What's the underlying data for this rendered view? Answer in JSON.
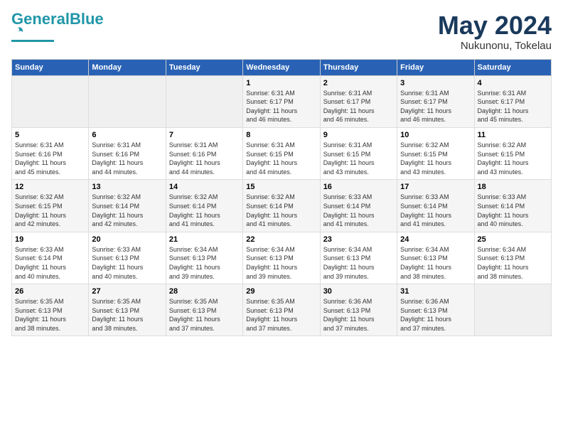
{
  "logo": {
    "general": "General",
    "blue": "Blue"
  },
  "title": {
    "month_year": "May 2024",
    "location": "Nukunonu, Tokelau"
  },
  "weekdays": [
    "Sunday",
    "Monday",
    "Tuesday",
    "Wednesday",
    "Thursday",
    "Friday",
    "Saturday"
  ],
  "weeks": [
    [
      {
        "num": "",
        "info": ""
      },
      {
        "num": "",
        "info": ""
      },
      {
        "num": "",
        "info": ""
      },
      {
        "num": "1",
        "info": "Sunrise: 6:31 AM\nSunset: 6:17 PM\nDaylight: 11 hours\nand 46 minutes."
      },
      {
        "num": "2",
        "info": "Sunrise: 6:31 AM\nSunset: 6:17 PM\nDaylight: 11 hours\nand 46 minutes."
      },
      {
        "num": "3",
        "info": "Sunrise: 6:31 AM\nSunset: 6:17 PM\nDaylight: 11 hours\nand 46 minutes."
      },
      {
        "num": "4",
        "info": "Sunrise: 6:31 AM\nSunset: 6:17 PM\nDaylight: 11 hours\nand 45 minutes."
      }
    ],
    [
      {
        "num": "5",
        "info": "Sunrise: 6:31 AM\nSunset: 6:16 PM\nDaylight: 11 hours\nand 45 minutes."
      },
      {
        "num": "6",
        "info": "Sunrise: 6:31 AM\nSunset: 6:16 PM\nDaylight: 11 hours\nand 44 minutes."
      },
      {
        "num": "7",
        "info": "Sunrise: 6:31 AM\nSunset: 6:16 PM\nDaylight: 11 hours\nand 44 minutes."
      },
      {
        "num": "8",
        "info": "Sunrise: 6:31 AM\nSunset: 6:15 PM\nDaylight: 11 hours\nand 44 minutes."
      },
      {
        "num": "9",
        "info": "Sunrise: 6:31 AM\nSunset: 6:15 PM\nDaylight: 11 hours\nand 43 minutes."
      },
      {
        "num": "10",
        "info": "Sunrise: 6:32 AM\nSunset: 6:15 PM\nDaylight: 11 hours\nand 43 minutes."
      },
      {
        "num": "11",
        "info": "Sunrise: 6:32 AM\nSunset: 6:15 PM\nDaylight: 11 hours\nand 43 minutes."
      }
    ],
    [
      {
        "num": "12",
        "info": "Sunrise: 6:32 AM\nSunset: 6:15 PM\nDaylight: 11 hours\nand 42 minutes."
      },
      {
        "num": "13",
        "info": "Sunrise: 6:32 AM\nSunset: 6:14 PM\nDaylight: 11 hours\nand 42 minutes."
      },
      {
        "num": "14",
        "info": "Sunrise: 6:32 AM\nSunset: 6:14 PM\nDaylight: 11 hours\nand 41 minutes."
      },
      {
        "num": "15",
        "info": "Sunrise: 6:32 AM\nSunset: 6:14 PM\nDaylight: 11 hours\nand 41 minutes."
      },
      {
        "num": "16",
        "info": "Sunrise: 6:33 AM\nSunset: 6:14 PM\nDaylight: 11 hours\nand 41 minutes."
      },
      {
        "num": "17",
        "info": "Sunrise: 6:33 AM\nSunset: 6:14 PM\nDaylight: 11 hours\nand 41 minutes."
      },
      {
        "num": "18",
        "info": "Sunrise: 6:33 AM\nSunset: 6:14 PM\nDaylight: 11 hours\nand 40 minutes."
      }
    ],
    [
      {
        "num": "19",
        "info": "Sunrise: 6:33 AM\nSunset: 6:14 PM\nDaylight: 11 hours\nand 40 minutes."
      },
      {
        "num": "20",
        "info": "Sunrise: 6:33 AM\nSunset: 6:13 PM\nDaylight: 11 hours\nand 40 minutes."
      },
      {
        "num": "21",
        "info": "Sunrise: 6:34 AM\nSunset: 6:13 PM\nDaylight: 11 hours\nand 39 minutes."
      },
      {
        "num": "22",
        "info": "Sunrise: 6:34 AM\nSunset: 6:13 PM\nDaylight: 11 hours\nand 39 minutes."
      },
      {
        "num": "23",
        "info": "Sunrise: 6:34 AM\nSunset: 6:13 PM\nDaylight: 11 hours\nand 39 minutes."
      },
      {
        "num": "24",
        "info": "Sunrise: 6:34 AM\nSunset: 6:13 PM\nDaylight: 11 hours\nand 38 minutes."
      },
      {
        "num": "25",
        "info": "Sunrise: 6:34 AM\nSunset: 6:13 PM\nDaylight: 11 hours\nand 38 minutes."
      }
    ],
    [
      {
        "num": "26",
        "info": "Sunrise: 6:35 AM\nSunset: 6:13 PM\nDaylight: 11 hours\nand 38 minutes."
      },
      {
        "num": "27",
        "info": "Sunrise: 6:35 AM\nSunset: 6:13 PM\nDaylight: 11 hours\nand 38 minutes."
      },
      {
        "num": "28",
        "info": "Sunrise: 6:35 AM\nSunset: 6:13 PM\nDaylight: 11 hours\nand 37 minutes."
      },
      {
        "num": "29",
        "info": "Sunrise: 6:35 AM\nSunset: 6:13 PM\nDaylight: 11 hours\nand 37 minutes."
      },
      {
        "num": "30",
        "info": "Sunrise: 6:36 AM\nSunset: 6:13 PM\nDaylight: 11 hours\nand 37 minutes."
      },
      {
        "num": "31",
        "info": "Sunrise: 6:36 AM\nSunset: 6:13 PM\nDaylight: 11 hours\nand 37 minutes."
      },
      {
        "num": "",
        "info": ""
      }
    ]
  ]
}
